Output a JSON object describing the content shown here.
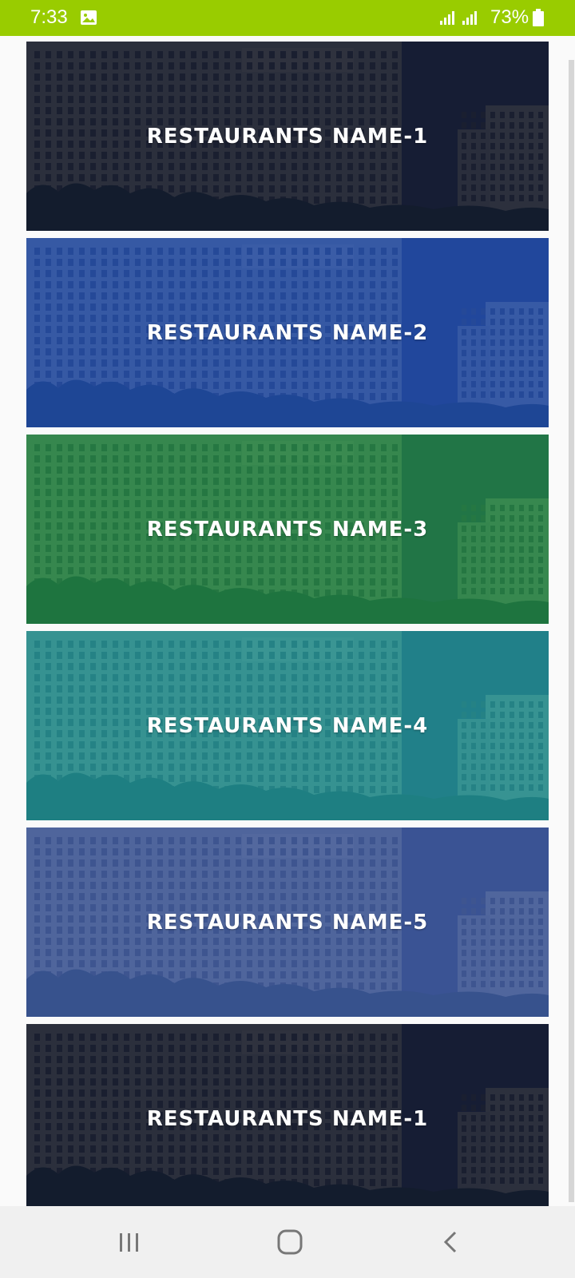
{
  "status_bar": {
    "time": "7:33",
    "battery": "73%",
    "background_color": "#99cc00",
    "icons": [
      "image-notification-icon",
      "signal-icon",
      "signal-icon",
      "battery-icon"
    ]
  },
  "restaurants": [
    {
      "name": "RESTAURANTS NAME-1",
      "tint": "#111a33"
    },
    {
      "name": "RESTAURANTS NAME-2",
      "tint": "#1f4fb8"
    },
    {
      "name": "RESTAURANTS NAME-3",
      "tint": "#1f8a4a"
    },
    {
      "name": "RESTAURANTS NAME-4",
      "tint": "#1f98a0"
    },
    {
      "name": "RESTAURANTS NAME-5",
      "tint": "#3f5fae"
    },
    {
      "name": "RESTAURANTS NAME-1",
      "tint": "#111a33"
    }
  ],
  "nav_bar": {
    "icons": [
      "recent-apps-icon",
      "home-icon",
      "back-icon"
    ]
  }
}
